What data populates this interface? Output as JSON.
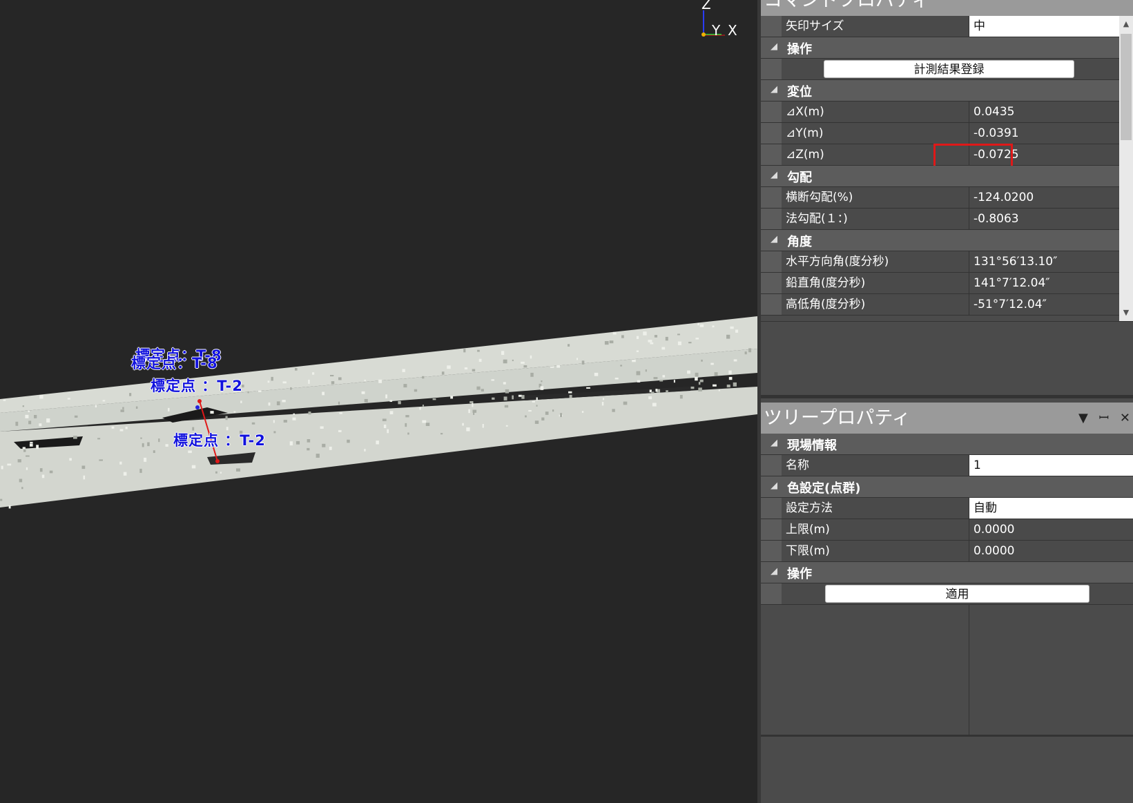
{
  "viewport": {
    "axis_labels": [
      "Z",
      "Y",
      "X"
    ],
    "point_labels": [
      {
        "text": "標定点：T-8"
      },
      {
        "text": "標定点：T-8"
      },
      {
        "text": "標定点 ：T-2"
      },
      {
        "text": "標定点 ：T-2"
      }
    ],
    "measure_line_color": "#e01818"
  },
  "command_property": {
    "title": "コマンドプロパティ",
    "rows": [
      {
        "type": "prop",
        "name": "矢印サイズ",
        "value": "中",
        "white": true
      },
      {
        "type": "cat",
        "label": "操作"
      },
      {
        "type": "button",
        "label": "計測結果登録"
      },
      {
        "type": "cat",
        "label": "変位"
      },
      {
        "type": "prop",
        "name": "⊿X(m)",
        "value": "0.0435"
      },
      {
        "type": "prop",
        "name": "⊿Y(m)",
        "value": "-0.0391"
      },
      {
        "type": "prop",
        "name": "⊿Z(m)",
        "value": "-0.0725",
        "highlight": true
      },
      {
        "type": "cat",
        "label": "勾配"
      },
      {
        "type": "prop",
        "name": "横断勾配(%)",
        "value": "-124.0200"
      },
      {
        "type": "prop",
        "name": "法勾配(１：)",
        "value": "-0.8063"
      },
      {
        "type": "cat",
        "label": "角度"
      },
      {
        "type": "prop",
        "name": "水平方向角(度分秒)",
        "value": "131°56′13.10″"
      },
      {
        "type": "prop",
        "name": "鉛直角(度分秒)",
        "value": "141°7′12.04″"
      },
      {
        "type": "prop",
        "name": "高低角(度分秒)",
        "value": "-51°7′12.04″"
      }
    ],
    "highlight_color": "#e01818"
  },
  "tree_property": {
    "title": "ツリープロパティ",
    "title_buttons": [
      "▼",
      "ꟷ",
      "✕"
    ],
    "rows": [
      {
        "type": "cat",
        "label": "現場情報"
      },
      {
        "type": "prop",
        "name": "名称",
        "value": "1",
        "white": true
      },
      {
        "type": "cat",
        "label": "色設定(点群)"
      },
      {
        "type": "prop",
        "name": "設定方法",
        "value": "自動",
        "white": true
      },
      {
        "type": "prop",
        "name": "上限(m)",
        "value": "0.0000"
      },
      {
        "type": "prop",
        "name": "下限(m)",
        "value": "0.0000"
      },
      {
        "type": "cat",
        "label": "操作"
      },
      {
        "type": "button",
        "label": "適用"
      }
    ]
  }
}
